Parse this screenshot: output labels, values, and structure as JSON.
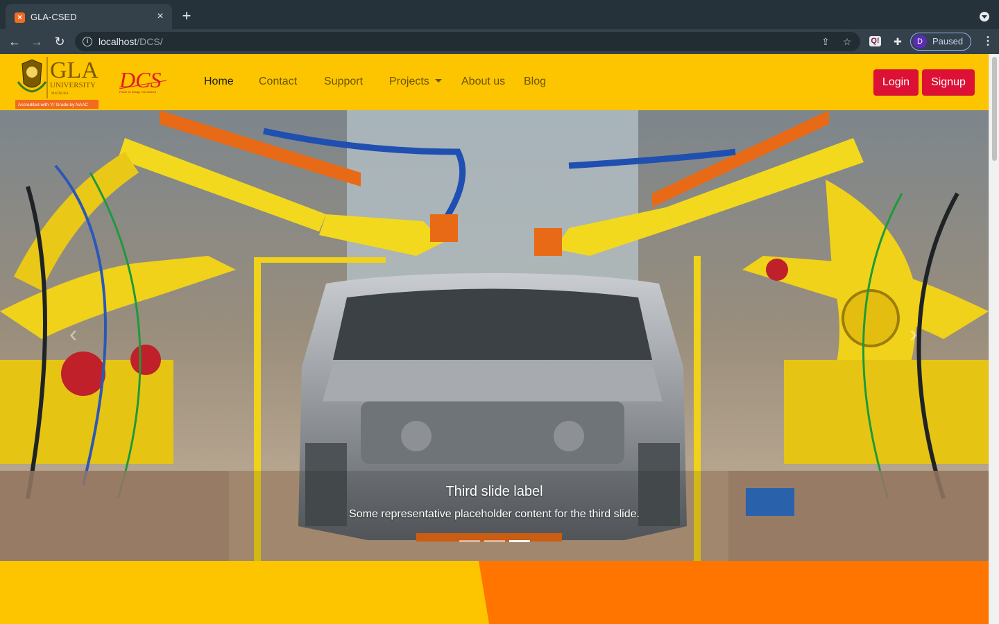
{
  "browser": {
    "tab_title": "GLA-CSED",
    "url_host": "localhost",
    "url_path": "/DCS/",
    "profile_initial": "D",
    "profile_status": "Paused"
  },
  "site": {
    "logo_gla_text": "GLA",
    "logo_university_text": "UNIVERSITY",
    "logo_mathura_text": "MATHURA",
    "logo_accredited_text": "Accredited with 'A' Grade by NAAC",
    "logo_dcs_text": "DCS",
    "logo_dcs_tagline": "Power To Design The Desired",
    "nav": [
      {
        "label": "Home"
      },
      {
        "label": "Contact"
      },
      {
        "label": "Support"
      },
      {
        "label": "Projects"
      },
      {
        "label": "About us"
      },
      {
        "label": "Blog"
      }
    ],
    "login_label": "Login",
    "signup_label": "Signup",
    "accent_yellow": "#fdc500",
    "accent_orange": "#ff7500",
    "button_red": "#dc1135"
  },
  "carousel": {
    "caption_title": "Third slide label",
    "caption_text": "Some representative placeholder content for the third slide.",
    "slide_count": 3,
    "active_slide": 3
  }
}
